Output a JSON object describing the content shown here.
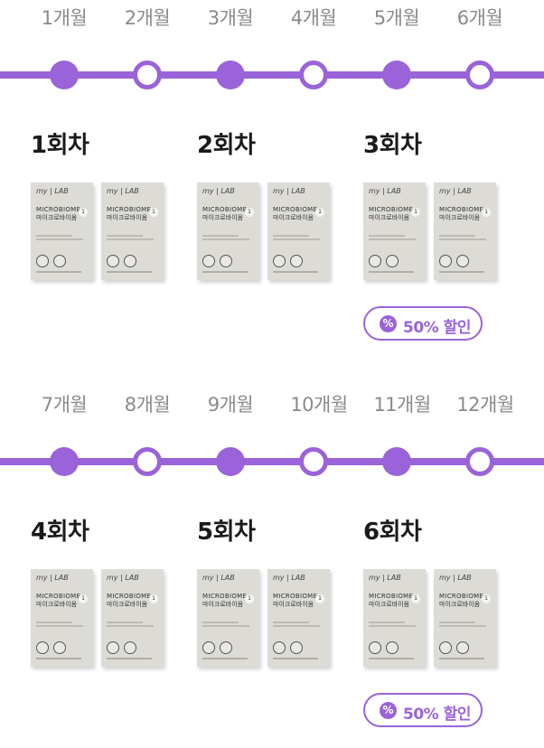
{
  "rows": [
    {
      "months": [
        "1개월",
        "2개월",
        "3개월",
        "4개월",
        "5개월",
        "6개월"
      ],
      "dots": [
        "filled",
        "hollow",
        "filled",
        "hollow",
        "filled",
        "hollow"
      ],
      "rounds": [
        "1회차",
        "2회차",
        "3회차"
      ],
      "badge": "50% 할인"
    },
    {
      "months": [
        "7개월",
        "8개월",
        "9개월",
        "10개월",
        "11개월",
        "12개월"
      ],
      "dots": [
        "filled",
        "hollow",
        "filled",
        "hollow",
        "filled",
        "hollow"
      ],
      "rounds": [
        "4회차",
        "5회차",
        "6회차"
      ],
      "badge": "50% 할인"
    }
  ],
  "product": {
    "brand_my": "my",
    "brand_lab": "LAB",
    "title_en": "MICROBIOME",
    "title_ko": "마이크로바이옴",
    "number": "1"
  },
  "colors": {
    "accent": "#9a63d9",
    "box": "#dcdbd6"
  },
  "icons": {
    "badge_icon": "percent-icon"
  }
}
